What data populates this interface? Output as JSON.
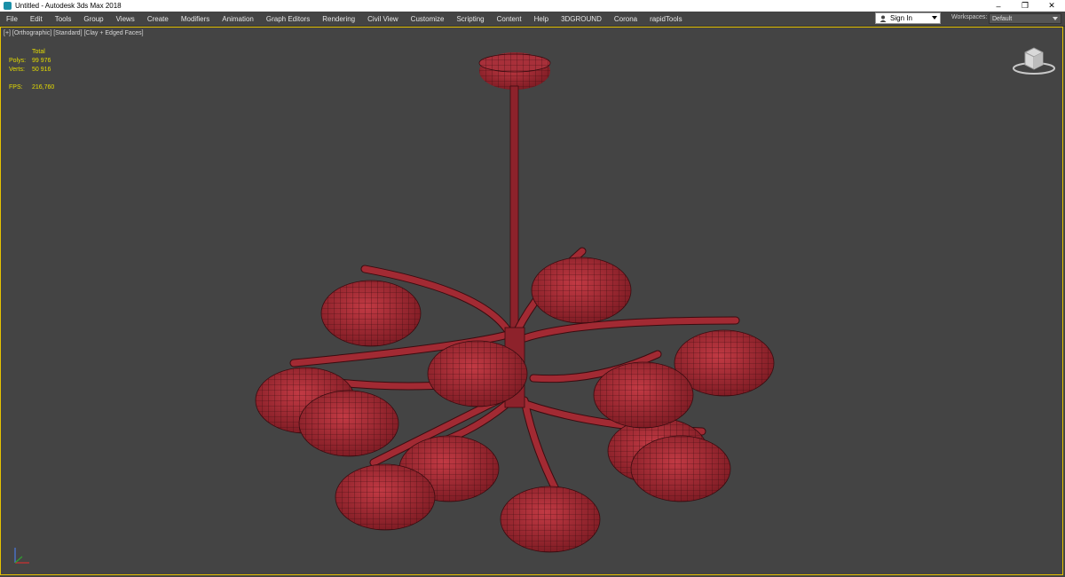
{
  "window": {
    "title": "Untitled - Autodesk 3ds Max 2018",
    "controls": {
      "minimize": "–",
      "restore": "❐",
      "close": "✕"
    }
  },
  "menu": {
    "items": [
      "File",
      "Edit",
      "Tools",
      "Group",
      "Views",
      "Create",
      "Modifiers",
      "Animation",
      "Graph Editors",
      "Rendering",
      "Civil View",
      "Customize",
      "Scripting",
      "Content",
      "Help",
      "3DGROUND",
      "Corona",
      "rapidTools"
    ]
  },
  "account": {
    "signin_label": "Sign In"
  },
  "workspaces": {
    "label": "Workspaces:",
    "value": "Default"
  },
  "viewport": {
    "label": "[+] [Orthographic] [Standard] [Clay + Edged Faces]",
    "stats": {
      "total_label": "Total",
      "polys_label": "Polys:",
      "polys_value": "99 976",
      "verts_label": "Verts:",
      "verts_value": "50 916",
      "fps_label": "FPS:",
      "fps_value": "216,760"
    },
    "model_color": "#a02830",
    "border_color": "#e5c200"
  }
}
